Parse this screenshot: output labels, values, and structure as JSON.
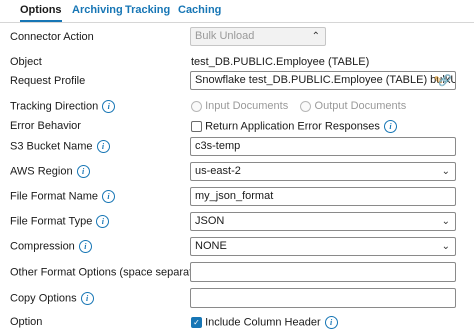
{
  "tabs": [
    "Options",
    "Archiving",
    "Tracking",
    "Caching"
  ],
  "labels": {
    "connector_action": "Connector Action",
    "object": "Object",
    "request_profile": "Request Profile",
    "tracking_direction": "Tracking Direction",
    "error_behavior": "Error Behavior",
    "s3_bucket": "S3 Bucket Name",
    "aws_region": "AWS Region",
    "file_format_name": "File Format Name",
    "file_format_type": "File Format Type",
    "compression": "Compression",
    "other_format": "Other Format Options (space separated)",
    "copy_options": "Copy Options",
    "option": "Option"
  },
  "values": {
    "connector_action": "Bulk Unload",
    "object": "test_DB.PUBLIC.Employee (TABLE)",
    "request_profile": "Snowflake test_DB.PUBLIC.Employee (TABLE) bulkUnloac",
    "tracking_input": "Input Documents",
    "tracking_output": "Output Documents",
    "error_behavior": "Return Application Error Responses",
    "s3_bucket": "c3s-temp",
    "aws_region": "us-east-2",
    "file_format_name": "my_json_format",
    "file_format_type": "JSON",
    "compression": "NONE",
    "other_format": "",
    "copy_options": "",
    "option": "Include Column Header"
  },
  "info_icon_glyph": "i",
  "colors": {
    "accent": "#1776b5",
    "pencil": "#d08a1a"
  }
}
